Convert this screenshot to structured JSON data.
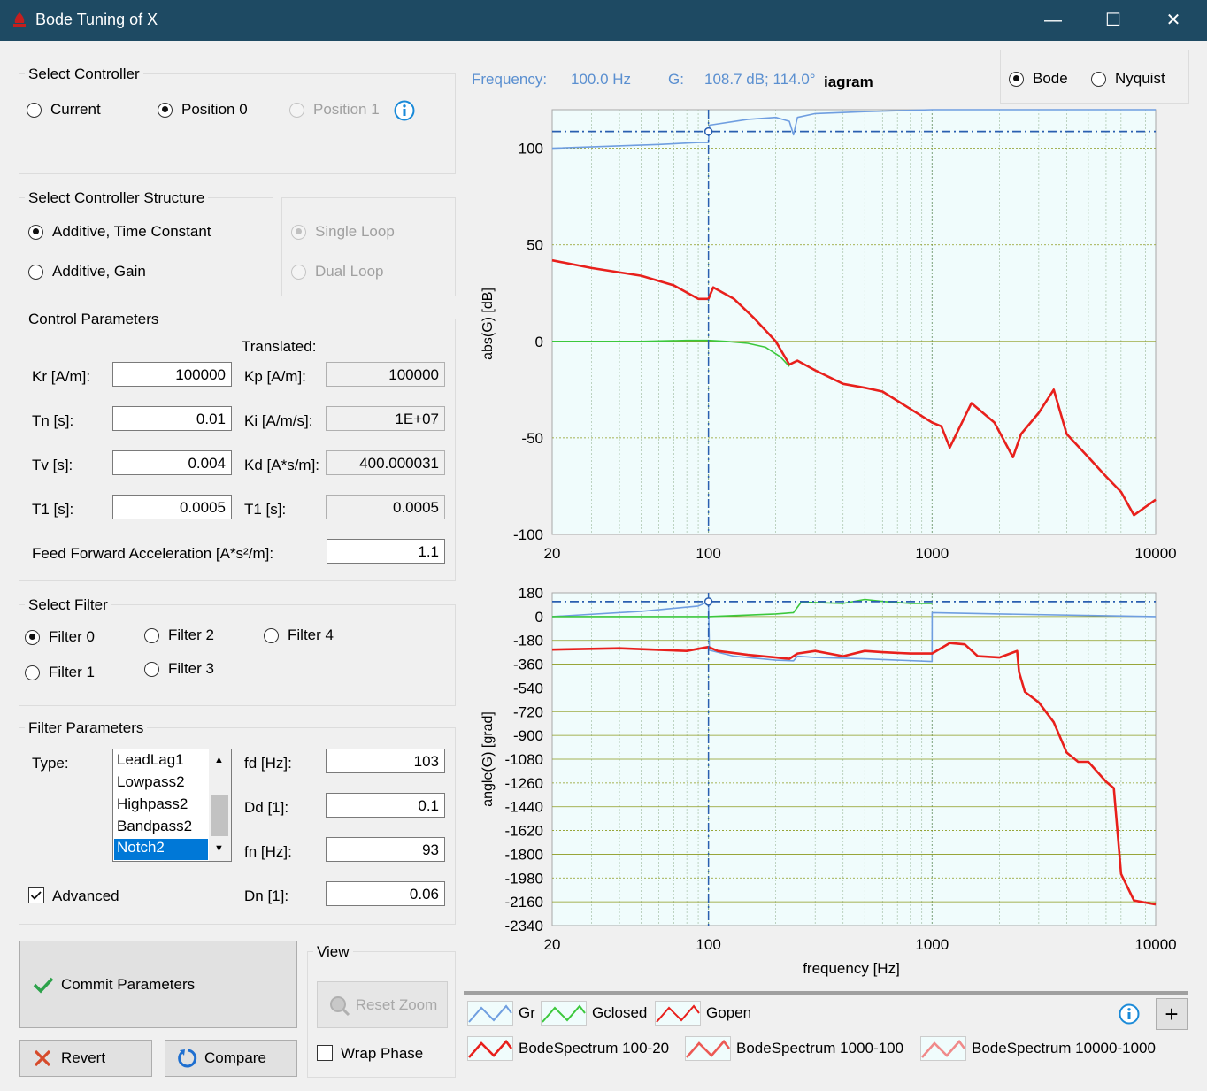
{
  "window": {
    "title": "Bode Tuning of X",
    "minimize": "—",
    "maximize": "☐",
    "close": "✕"
  },
  "select_controller": {
    "title": "Select Controller",
    "options": [
      {
        "label": "Current",
        "checked": false,
        "enabled": true
      },
      {
        "label": "Position 0",
        "checked": true,
        "enabled": true
      },
      {
        "label": "Position 1",
        "checked": false,
        "enabled": false
      }
    ],
    "info_icon": "info-icon"
  },
  "structure": {
    "title": "Select Controller Structure",
    "options": [
      {
        "label": "Additive, Time Constant",
        "checked": true
      },
      {
        "label": "Additive, Gain",
        "checked": false
      }
    ],
    "loop_options": [
      {
        "label": "Single Loop",
        "checked": true,
        "enabled": false
      },
      {
        "label": "Dual Loop",
        "checked": false,
        "enabled": false
      }
    ]
  },
  "control_params": {
    "title": "Control Parameters",
    "translated_label": "Translated:",
    "rows": [
      {
        "label": "Kr [A/m]:",
        "value": "100000",
        "t_label": "Kp [A/m]:",
        "t_value": "100000"
      },
      {
        "label": "Tn [s]:",
        "value": "0.01",
        "t_label": "Ki [A/m/s]:",
        "t_value": "1E+07"
      },
      {
        "label": "Tv [s]:",
        "value": "0.004",
        "t_label": "Kd [A*s/m]:",
        "t_value": "400.000031"
      },
      {
        "label": "T1 [s]:",
        "value": "0.0005",
        "t_label": "T1 [s]:",
        "t_value": "0.0005"
      }
    ],
    "ff_label": "Feed Forward Acceleration [A*s²/m]:",
    "ff_value": "1.1"
  },
  "select_filter": {
    "title": "Select Filter",
    "options": [
      {
        "label": "Filter 0",
        "checked": true
      },
      {
        "label": "Filter 1",
        "checked": false
      },
      {
        "label": "Filter 2",
        "checked": false
      },
      {
        "label": "Filter 3",
        "checked": false
      },
      {
        "label": "Filter 4",
        "checked": false
      }
    ]
  },
  "filter_params": {
    "title": "Filter Parameters",
    "type_label": "Type:",
    "types": [
      "LeadLag1",
      "Lowpass2",
      "Highpass2",
      "Bandpass2",
      "Notch2"
    ],
    "selected_type": "Notch2",
    "fields": [
      {
        "label": "fd [Hz]:",
        "value": "103"
      },
      {
        "label": "Dd [1]:",
        "value": "0.1"
      },
      {
        "label": "fn [Hz]:",
        "value": "93"
      },
      {
        "label": "Dn [1]:",
        "value": "0.06"
      }
    ],
    "advanced_label": "Advanced",
    "advanced_checked": true
  },
  "actions": {
    "commit": "Commit Parameters",
    "revert": "Revert",
    "compare": "Compare"
  },
  "view": {
    "title": "View",
    "reset_zoom": "Reset Zoom",
    "wrap_phase": "Wrap Phase",
    "wrap_checked": false
  },
  "readout": {
    "freq_label": "Frequency:",
    "freq_value": "100.0 Hz",
    "g_label": "G:",
    "g_value": "108.7 dB; 114.0°",
    "overlap_text": "iagram"
  },
  "plot_mode": {
    "options": [
      {
        "label": "Bode",
        "checked": true
      },
      {
        "label": "Nyquist",
        "checked": false
      }
    ]
  },
  "chart_data": [
    {
      "type": "line",
      "ylabel": "abs(G) [dB]",
      "xlabel": "",
      "xscale": "log",
      "xlim": [
        20,
        10000
      ],
      "ylim": [
        -100,
        120
      ],
      "xticks": [
        "20",
        "100",
        "1000",
        "10000"
      ],
      "yticks": [
        "100",
        "50",
        "0",
        "-50",
        "-100"
      ],
      "cursor_x": 100,
      "cursor_y": 108.7,
      "series": [
        {
          "name": "Gr",
          "color": "#6f9ee0",
          "x": [
            20,
            60,
            90,
            100,
            101,
            150,
            200,
            230,
            240,
            250,
            300,
            500,
            1000,
            3000,
            10000
          ],
          "y": [
            100,
            102,
            103,
            103,
            112,
            115,
            116,
            114,
            107,
            116,
            118,
            119,
            120,
            120,
            120
          ]
        },
        {
          "name": "Gclosed",
          "color": "#3cc83c",
          "x": [
            20,
            50,
            80,
            100,
            120,
            150,
            180,
            210,
            230
          ],
          "y": [
            0,
            0,
            0.5,
            0.5,
            0,
            -1,
            -3,
            -8,
            -13
          ]
        },
        {
          "name": "Gopen",
          "color": "#e8201c",
          "x": [
            20,
            30,
            50,
            70,
            90,
            100,
            105,
            130,
            160,
            200,
            230,
            250,
            300,
            400,
            500,
            600,
            800,
            1000,
            1100,
            1200,
            1500,
            1900,
            2300,
            2500,
            3000,
            3500,
            4000,
            5000,
            6000,
            7000,
            8000,
            10000
          ],
          "y": [
            42,
            38,
            34,
            29,
            22,
            22,
            28,
            22,
            12,
            0,
            -12,
            -10,
            -15,
            -22,
            -24,
            -26,
            -35,
            -42,
            -44,
            -55,
            -32,
            -42,
            -60,
            -48,
            -37,
            -25,
            -48,
            -60,
            -70,
            -78,
            -90,
            -82
          ]
        }
      ]
    },
    {
      "type": "line",
      "ylabel": "angle(G) [grad]",
      "xlabel": "frequency [Hz]",
      "xscale": "log",
      "xlim": [
        20,
        10000
      ],
      "ylim": [
        -2340,
        180
      ],
      "xticks": [
        "20",
        "100",
        "1000",
        "10000"
      ],
      "yticks": [
        "180",
        "0",
        "-180",
        "-360",
        "-540",
        "-720",
        "-900",
        "-1080",
        "-1260",
        "-1440",
        "-1620",
        "-1800",
        "-1980",
        "-2160",
        "-2340"
      ],
      "cursor_x": 100,
      "cursor_y": 114,
      "series": [
        {
          "name": "Gr",
          "color": "#6f9ee0",
          "x": [
            20,
            50,
            90,
            100,
            101,
            130,
            200,
            240,
            250,
            300,
            500,
            1000,
            1001,
            2000,
            10000
          ],
          "y": [
            0,
            40,
            80,
            114,
            -255,
            -300,
            -330,
            -335,
            -300,
            -310,
            -320,
            -340,
            30,
            20,
            0
          ]
        },
        {
          "name": "Gclosed",
          "color": "#3cc83c",
          "x": [
            20,
            100,
            200,
            240,
            260,
            400,
            500,
            600,
            800,
            1000
          ],
          "y": [
            0,
            0,
            20,
            30,
            110,
            100,
            130,
            115,
            100,
            100
          ]
        },
        {
          "name": "Gopen",
          "color": "#e8201c",
          "x": [
            20,
            40,
            80,
            100,
            110,
            150,
            200,
            230,
            250,
            300,
            400,
            500,
            600,
            800,
            1000,
            1200,
            1400,
            1600,
            2000,
            2400,
            2450,
            2600,
            3000,
            3500,
            4000,
            4500,
            5000,
            6000,
            6500,
            7000,
            8000,
            10000
          ],
          "y": [
            -250,
            -240,
            -260,
            -230,
            -260,
            -290,
            -310,
            -320,
            -280,
            -260,
            -300,
            -260,
            -270,
            -280,
            -280,
            -200,
            -210,
            -300,
            -310,
            -260,
            -420,
            -570,
            -650,
            -800,
            -1030,
            -1100,
            -1100,
            -1250,
            -1300,
            -1950,
            -2150,
            -2180
          ]
        }
      ]
    }
  ],
  "legend": {
    "items": [
      {
        "name": "Gr",
        "color": "#6f9ee0"
      },
      {
        "name": "Gclosed",
        "color": "#3cc83c"
      },
      {
        "name": "Gopen",
        "color": "#e8201c"
      },
      {
        "name": "BodeSpectrum 100-20",
        "color": "#e8201c"
      },
      {
        "name": "BodeSpectrum 1000-100",
        "color": "#ec5a55"
      },
      {
        "name": "BodeSpectrum 10000-1000",
        "color": "#f08a8a"
      }
    ],
    "info_icon": "info-icon",
    "add_label": "+"
  }
}
